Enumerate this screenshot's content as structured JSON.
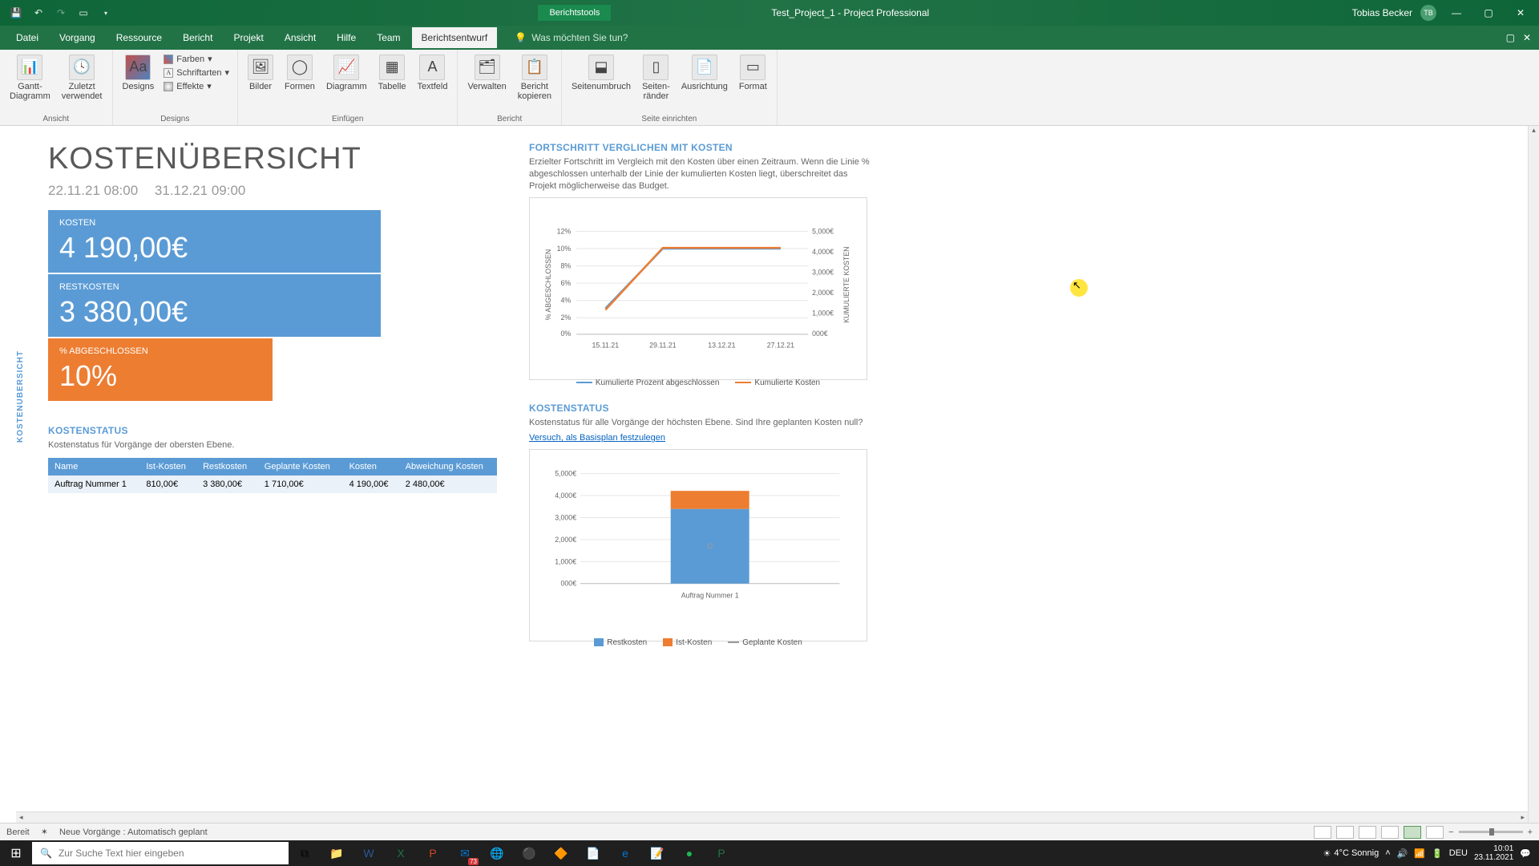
{
  "titlebar": {
    "tool_tab": "Berichtstools",
    "doc": "Test_Project_1  -  Project Professional",
    "user": "Tobias Becker",
    "initials": "TB"
  },
  "tabs": {
    "items": [
      "Datei",
      "Vorgang",
      "Ressource",
      "Bericht",
      "Projekt",
      "Ansicht",
      "Hilfe",
      "Team",
      "Berichtsentwurf"
    ],
    "active": 8,
    "tellme": "Was möchten Sie tun?"
  },
  "ribbon": {
    "ansicht": {
      "gantt": "Gantt-\nDiagramm",
      "recent": "Zuletzt\nverwendet",
      "label": "Ansicht"
    },
    "designs": {
      "designs": "Designs",
      "farben": "Farben",
      "schrift": "Schriftarten",
      "effekte": "Effekte",
      "label": "Designs"
    },
    "einfugen": {
      "bilder": "Bilder",
      "formen": "Formen",
      "diagramm": "Diagramm",
      "tabelle": "Tabelle",
      "textfeld": "Textfeld",
      "label": "Einfügen"
    },
    "bericht": {
      "verwalten": "Verwalten",
      "kopieren": "Bericht\nkopieren",
      "label": "Bericht"
    },
    "seite": {
      "umbruch": "Seitenumbruch",
      "rander": "Seiten-\nränder",
      "ausrichtung": "Ausrichtung",
      "format": "Format",
      "label": "Seite einrichten"
    }
  },
  "report": {
    "side_tab": "KOSTENÜBERSICHT",
    "title": "KOSTENÜBERSICHT",
    "date_from": "22.11.21 08:00",
    "date_to": "31.12.21 09:00",
    "tiles": {
      "kosten_label": "KOSTEN",
      "kosten_value": "4 190,00€",
      "rest_label": "RESTKOSTEN",
      "rest_value": "3 380,00€",
      "pct_label": "% ABGESCHLOSSEN",
      "pct_value": "10%"
    },
    "progress": {
      "title": "FORTSCHRITT VERGLICHEN MIT KOSTEN",
      "desc": "Erzielter Fortschritt im Vergleich mit den Kosten über einen Zeitraum. Wenn die Linie % abgeschlossen unterhalb der Linie der kumulierten Kosten liegt, überschreitet das Projekt möglicherweise das Budget.",
      "y1_label": "% ABGESCHLOSSEN",
      "y2_label": "KUMULIERTE KOSTEN",
      "legend1": "Kumulierte Prozent abgeschlossen",
      "legend2": "Kumulierte Kosten"
    },
    "status_chart": {
      "title": "KOSTENSTATUS",
      "desc": "Kostenstatus für alle Vorgänge der höchsten Ebene. Sind Ihre geplanten Kosten null?",
      "link": "Versuch, als Basisplan festzulegen",
      "legend_rest": "Restkosten",
      "legend_ist": "Ist-Kosten",
      "legend_plan": "Geplante Kosten",
      "category": "Auftrag Nummer 1"
    },
    "table": {
      "title": "KOSTENSTATUS",
      "desc": "Kostenstatus für Vorgänge der obersten Ebene.",
      "headers": [
        "Name",
        "Ist-Kosten",
        "Restkosten",
        "Geplante Kosten",
        "Kosten",
        "Abweichung Kosten"
      ],
      "rows": [
        [
          "Auftrag Nummer 1",
          "810,00€",
          "3 380,00€",
          "1 710,00€",
          "4 190,00€",
          "2 480,00€"
        ]
      ]
    }
  },
  "chart_data": [
    {
      "type": "line",
      "x": [
        "15.11.21",
        "29.11.21",
        "13.12.21",
        "27.12.21"
      ],
      "y1_ticks": [
        "0%",
        "2%",
        "4%",
        "6%",
        "8%",
        "10%",
        "12%"
      ],
      "y2_ticks": [
        "000€",
        "1,000€",
        "2,000€",
        "3,000€",
        "4,000€",
        "5,000€"
      ],
      "series": [
        {
          "name": "Kumulierte Prozent abgeschlossen",
          "axis": "left",
          "color": "#5b9bd5",
          "values": [
            3,
            10,
            10,
            10
          ]
        },
        {
          "name": "Kumulierte Kosten",
          "axis": "right",
          "color": "#ed7d31",
          "values": [
            1200,
            4190,
            4190,
            4190
          ]
        }
      ],
      "y1_range": [
        0,
        12
      ],
      "y2_range": [
        0,
        5000
      ]
    },
    {
      "type": "bar-stacked",
      "categories": [
        "Auftrag Nummer 1"
      ],
      "y_ticks": [
        "000€",
        "1,000€",
        "2,000€",
        "3,000€",
        "4,000€",
        "5,000€"
      ],
      "series": [
        {
          "name": "Restkosten",
          "color": "#5b9bd5",
          "values": [
            3380
          ]
        },
        {
          "name": "Ist-Kosten",
          "color": "#ed7d31",
          "values": [
            810
          ]
        }
      ],
      "markers": [
        {
          "name": "Geplante Kosten",
          "values": [
            1710
          ]
        }
      ],
      "ylim": [
        0,
        5000
      ]
    }
  ],
  "statusbar": {
    "ready": "Bereit",
    "sched": "Neue Vorgänge : Automatisch geplant"
  },
  "taskbar": {
    "search_placeholder": "Zur Suche Text hier eingeben",
    "weather": "4°C  Sonnig",
    "lang": "DEU",
    "time": "10:01",
    "date": "23.11.2021",
    "badge": "73"
  }
}
